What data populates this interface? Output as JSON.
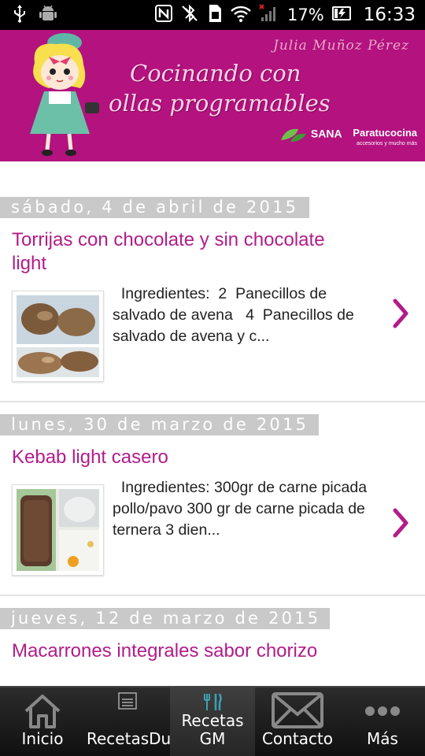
{
  "statusbar": {
    "battery": "17%",
    "time": "16:33"
  },
  "banner": {
    "author": "Julia Muñoz Pérez",
    "title_line1": "Cocinando con",
    "title_line2": "ollas programables",
    "sponsor1": "SANA",
    "sponsor2_main": "Paratucocina",
    "sponsor2_sub": "accesorios y mucho más"
  },
  "posts": [
    {
      "date": "sábado, 4 de abril de 2015",
      "title": "Torrijas con chocolate y sin chocolate light",
      "excerpt": "  Ingredientes:  2  Panecillos de salvado de avena   4  Panecillos de salvado de avena y c..."
    },
    {
      "date": "lunes, 30 de marzo de 2015",
      "title": "Kebab light casero",
      "excerpt": "  Ingredientes: 300gr de carne picada pollo/pavo 300 gr de carne picada de ternera 3 dien..."
    },
    {
      "date": "jueves, 12 de marzo de 2015",
      "title": "Macarrones integrales sabor chorizo",
      "excerpt": ""
    }
  ],
  "nav": [
    {
      "label": "Inicio",
      "icon": "home-icon"
    },
    {
      "label": "RecetasDukan",
      "icon": "menu-icon"
    },
    {
      "label": "Recetas GM",
      "icon": "cutlery-icon"
    },
    {
      "label": "Contacto",
      "icon": "envelope-icon"
    },
    {
      "label": "Más",
      "icon": "more-icon"
    }
  ],
  "colors": {
    "accent": "#b21c8a",
    "banner": "#b3127f",
    "date_bar": "#c9c9c9",
    "nav_bg": "#1a1a1a"
  }
}
